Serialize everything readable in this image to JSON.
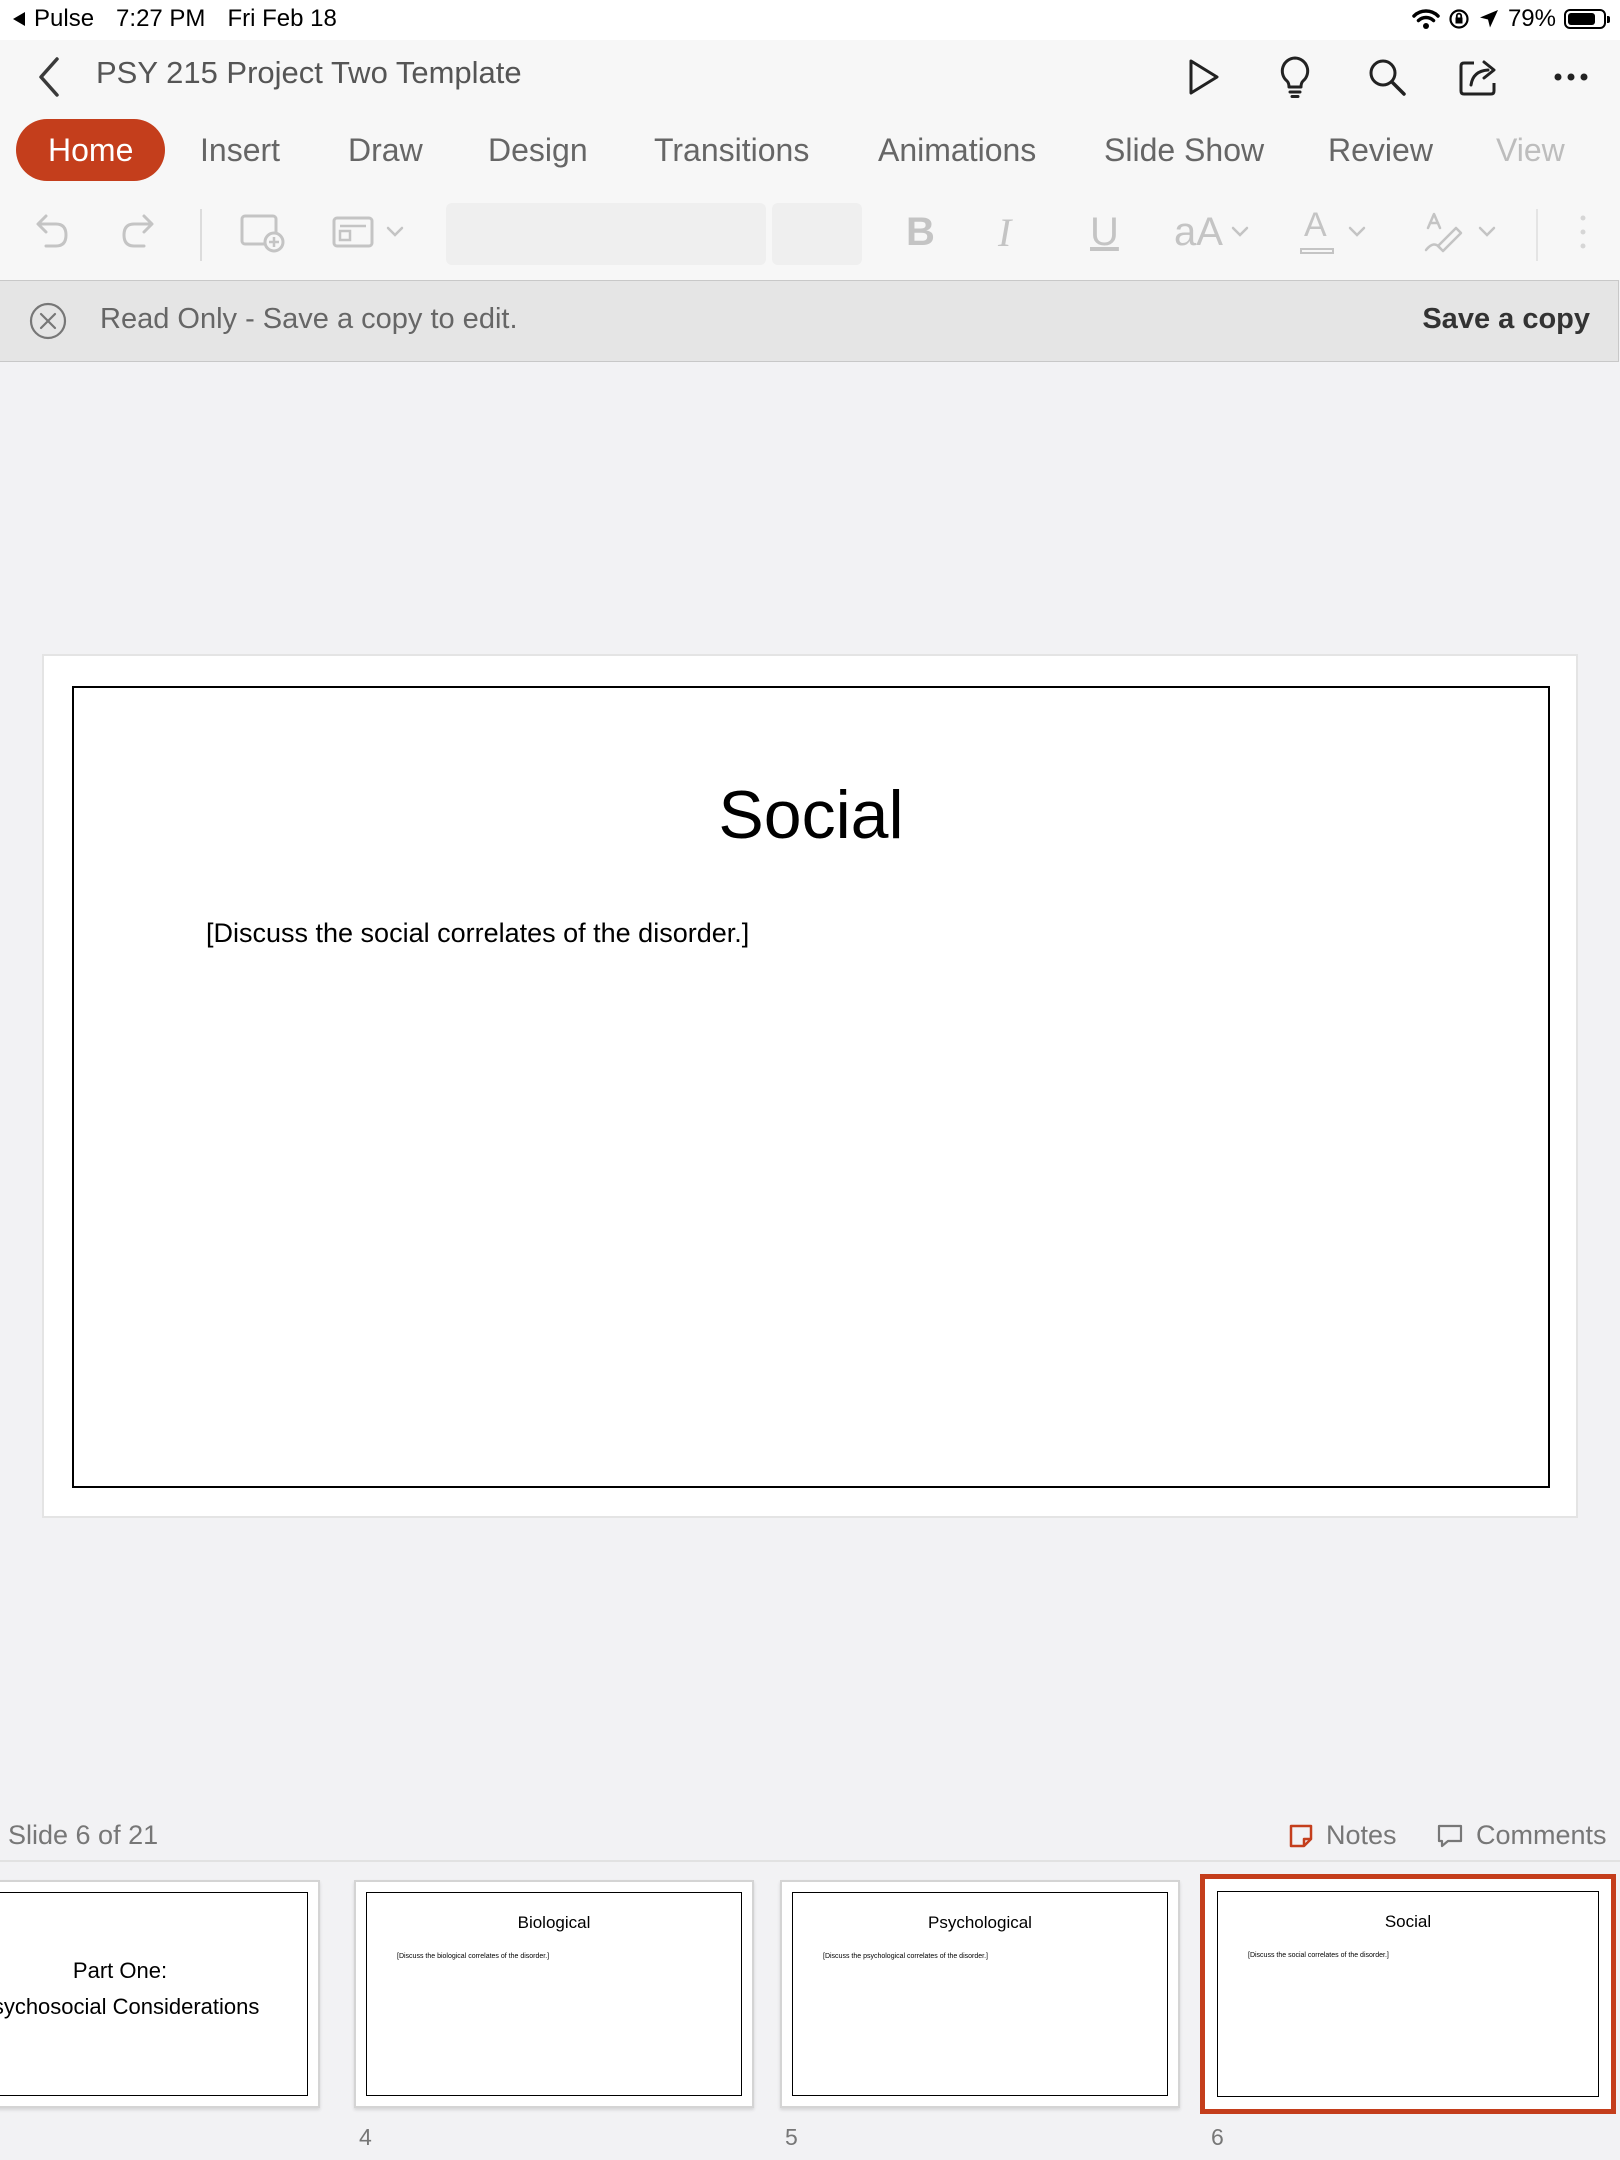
{
  "status_bar": {
    "back_app": "Pulse",
    "time": "7:27 PM",
    "date": "Fri Feb 18",
    "battery": "79%",
    "battery_level": 0.79
  },
  "title_bar": {
    "doc_title": "PSY 215 Project Two Template",
    "icons": [
      "back-chevron-icon",
      "play-icon",
      "lightbulb-icon",
      "search-icon",
      "share-icon",
      "more-icon"
    ]
  },
  "tabs": [
    {
      "label": "Home",
      "active": true
    },
    {
      "label": "Insert"
    },
    {
      "label": "Draw"
    },
    {
      "label": "Design"
    },
    {
      "label": "Transitions"
    },
    {
      "label": "Animations"
    },
    {
      "label": "Slide Show"
    },
    {
      "label": "Review"
    },
    {
      "label": "View"
    }
  ],
  "ribbon": {
    "bold": "B",
    "italic": "I",
    "underline": "U",
    "font_size_toggle": "aA",
    "font_color": "A"
  },
  "read_only_bar": {
    "message": "Read Only - Save a copy to edit.",
    "action": "Save a copy"
  },
  "slide": {
    "title": "Social",
    "body": "[Discuss the social correlates of the disorder.]"
  },
  "footer": {
    "slide_counter": "Slide 6 of 21",
    "notes": "Notes",
    "comments": "Comments"
  },
  "thumbnails": [
    {
      "number": "",
      "title_line1": "Part One:",
      "title_line2": "psychosocial  Considerations"
    },
    {
      "number": "4",
      "title": "Biological",
      "body": "[Discuss the biological correlates of the disorder.]"
    },
    {
      "number": "5",
      "title": "Psychological",
      "body": "[Discuss the psychological correlates of the disorder.]"
    },
    {
      "number": "6",
      "title": "Social",
      "body": "[Discuss the social correlates of the disorder.]",
      "selected": true
    }
  ],
  "colors": {
    "accent": "#c43e1c",
    "background": "#f2f2f4",
    "toolbar": "#f7f7f7"
  }
}
